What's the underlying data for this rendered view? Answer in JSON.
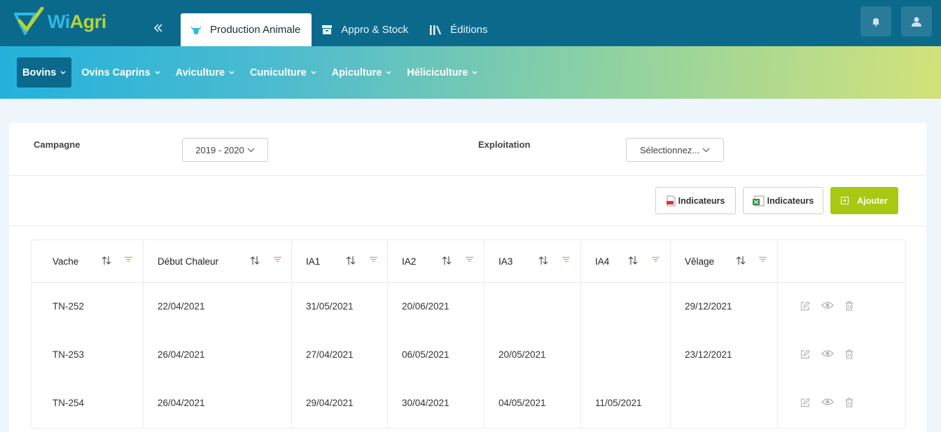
{
  "app": {
    "logo_text_1": "Wi",
    "logo_text_2": "Agri",
    "colors": {
      "topbar": "#0b6a8c",
      "accent_green": "#a7c913",
      "brand_blue": "#2fb8e3"
    }
  },
  "topbar": {
    "collapse_icon": "double-chevron-left-icon",
    "tabs": [
      {
        "label": "Production Animale",
        "icon": "cow-icon",
        "active": true
      },
      {
        "label": "Appro & Stock",
        "icon": "box-icon",
        "active": false
      },
      {
        "label": "Éditions",
        "icon": "books-icon",
        "active": false
      }
    ],
    "notifications_icon": "bell-icon",
    "user_icon": "user-icon"
  },
  "subnav": {
    "items": [
      {
        "label": "Bovins",
        "active": true
      },
      {
        "label": "Ovins Caprins",
        "active": false
      },
      {
        "label": "Aviculture",
        "active": false
      },
      {
        "label": "Cuniculture",
        "active": false
      },
      {
        "label": "Apiculture",
        "active": false
      },
      {
        "label": "Héliciculture",
        "active": false
      }
    ]
  },
  "filters": {
    "campagne_label": "Campagne",
    "campagne_value": "2019 - 2020",
    "exploitation_label": "Exploitation",
    "exploitation_value": "Sélectionnez..."
  },
  "actions": {
    "pdf_button": "Indicateurs",
    "excel_button": "Indicateurs",
    "add_button": "Ajouter"
  },
  "table": {
    "columns": [
      "Vache",
      "Début Chaleur",
      "IA1",
      "IA2",
      "IA3",
      "IA4",
      "Vêlage"
    ],
    "rows": [
      [
        "TN-252",
        "22/04/2021",
        "31/05/2021",
        "20/06/2021",
        "",
        "",
        "29/12/2021"
      ],
      [
        "TN-253",
        "26/04/2021",
        "27/04/2021",
        "06/05/2021",
        "20/05/2021",
        "",
        "23/12/2021"
      ],
      [
        "TN-254",
        "26/04/2021",
        "29/04/2021",
        "30/04/2021",
        "04/05/2021",
        "11/05/2021",
        ""
      ]
    ],
    "row_action_icons": [
      "edit-icon",
      "eye-icon",
      "trash-icon"
    ]
  }
}
